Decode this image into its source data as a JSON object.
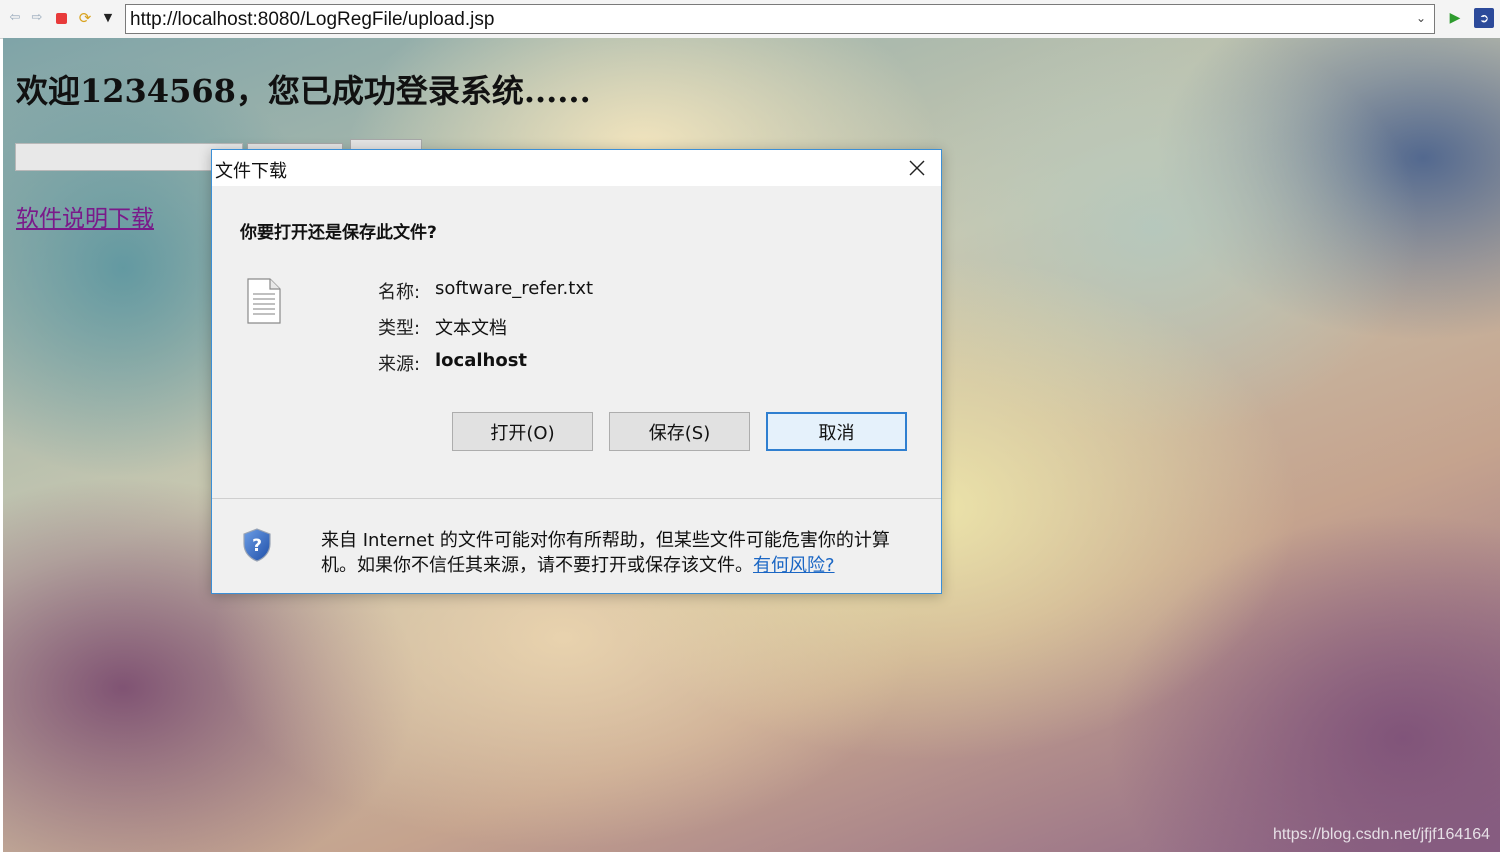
{
  "browser": {
    "url": "http://localhost:8080/LogRegFile/upload.jsp"
  },
  "page": {
    "welcome": "欢迎1234568，您已成功登录系统......",
    "doc_link": "软件说明下载",
    "watermark": "https://blog.csdn.net/jfjf164164"
  },
  "dialog": {
    "title": "文件下载",
    "question": "你要打开还是保存此文件?",
    "name_label": "名称:",
    "name_value": "software_refer.txt",
    "type_label": "类型:",
    "type_value": "文本文档",
    "from_label": "来源:",
    "from_value": "localhost",
    "open_button": "打开(O)",
    "save_button": "保存(S)",
    "cancel_button": "取消",
    "warning": "来自 Internet 的文件可能对你有所帮助，但某些文件可能危害你的计算机。如果你不信任其来源，请不要打开或保存该文件。",
    "risk_link": "有何风险?"
  },
  "icons": {
    "back": "back-arrow-icon",
    "forward": "forward-arrow-icon",
    "stop": "stop-icon",
    "refresh": "refresh-icon",
    "menu": "dropdown-menu-icon",
    "go": "go-arrow-icon",
    "extension": "browser-extension-icon",
    "close": "close-icon",
    "file": "text-file-icon",
    "shield": "security-shield-icon"
  },
  "colors": {
    "dialog_border": "#3b8fd6",
    "link_visited": "#7a1a8a",
    "link_blue": "#1a66c4",
    "stop_red": "#e83a3a"
  }
}
